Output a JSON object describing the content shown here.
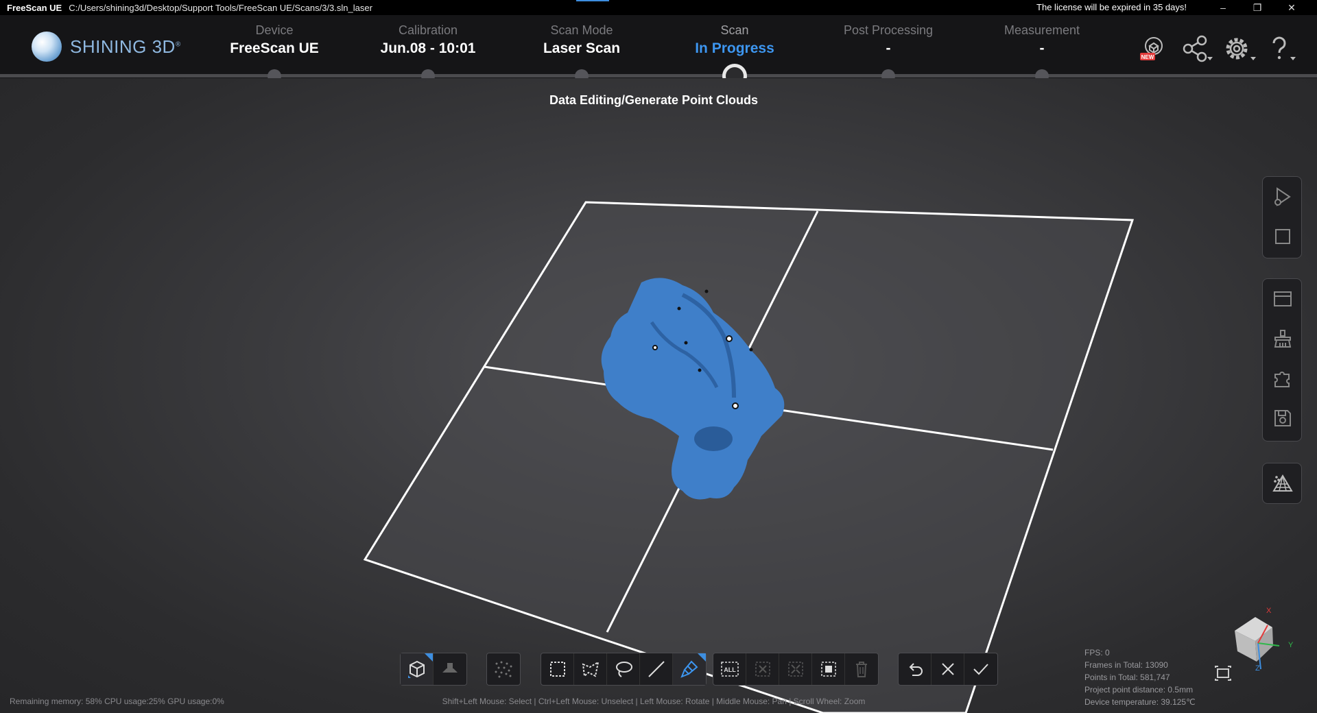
{
  "titlebar": {
    "app_name": "FreeScan UE",
    "path": "C:/Users/shining3d/Desktop/Support Tools/FreeScan UE/Scans/3/3.sln_laser",
    "license": "The license will be expired in 35 days!",
    "minimize": "–",
    "restore": "❐",
    "close": "✕"
  },
  "brand": {
    "name": "SHINING 3D",
    "mark": "®"
  },
  "steps": [
    {
      "label": "Device",
      "value": "FreeScan UE",
      "state": "done"
    },
    {
      "label": "Calibration",
      "value": "Jun.08 - 10:01",
      "state": "done"
    },
    {
      "label": "Scan Mode",
      "value": "Laser Scan",
      "state": "done"
    },
    {
      "label": "Scan",
      "value": "In Progress",
      "state": "active"
    },
    {
      "label": "Post Processing",
      "value": "-",
      "state": "pending"
    },
    {
      "label": "Measurement",
      "value": "-",
      "state": "pending"
    }
  ],
  "header_icons": {
    "badge": "NEW"
  },
  "subtitle": "Data Editing/Generate Point Clouds",
  "toolbar": {
    "all_label": "ALL"
  },
  "hint": "Shift+Left Mouse: Select | Ctrl+Left Mouse: Unselect | Left Mouse: Rotate | Middle Mouse: Pan | Scroll Wheel: Zoom",
  "status": {
    "memory": "Remaining memory: 58%",
    "cpu": "CPU usage:25%",
    "gpu": "GPU usage:0%"
  },
  "stats": {
    "fps": "FPS:  0",
    "frames": "Frames in Total: 13090",
    "points": "Points in Total: 581,747",
    "distance": "Project point distance: 0.5mm",
    "temperature": "Device temperature: 39.125℃"
  },
  "axes": {
    "x": "X",
    "y": "Y",
    "z": "Z"
  },
  "colors": {
    "accent": "#3d96f0",
    "model": "#3f7fc9",
    "header_bg": "#151517"
  }
}
